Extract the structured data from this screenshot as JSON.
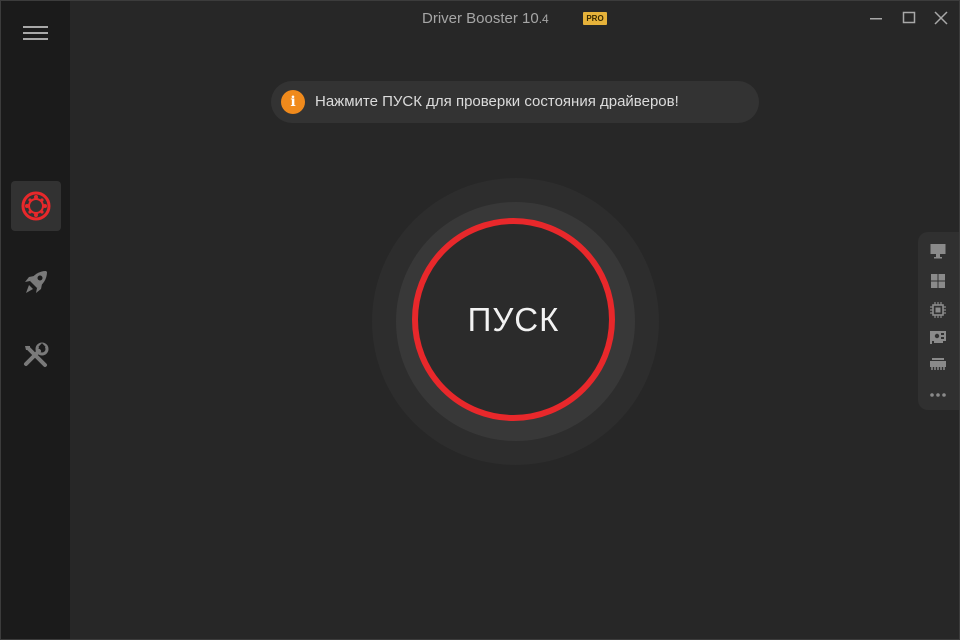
{
  "window": {
    "title": "Driver Booster 10",
    "version": ".4",
    "badge": "PRO"
  },
  "sidebar": {
    "menu_icon": "hamburger-menu-icon",
    "items": [
      {
        "icon": "scan-target-icon",
        "active": true
      },
      {
        "icon": "rocket-icon",
        "active": false
      },
      {
        "icon": "tools-icon",
        "active": false
      }
    ]
  },
  "notice": {
    "icon": "info-icon",
    "icon_glyph": "i",
    "text": "Нажмите ПУСК для проверки состояния драйверов!"
  },
  "scan": {
    "label": "ПУСК"
  },
  "right_panel": {
    "icons": [
      "monitor-icon",
      "windows-icon",
      "chip-icon",
      "network-card-icon",
      "memory-icon",
      "more-icon"
    ]
  },
  "colors": {
    "accent_red": "#e8282b",
    "info_orange": "#f08a1c",
    "pro_gold": "#e6b23a",
    "background": "#272727",
    "sidebar": "#1b1b1b"
  }
}
